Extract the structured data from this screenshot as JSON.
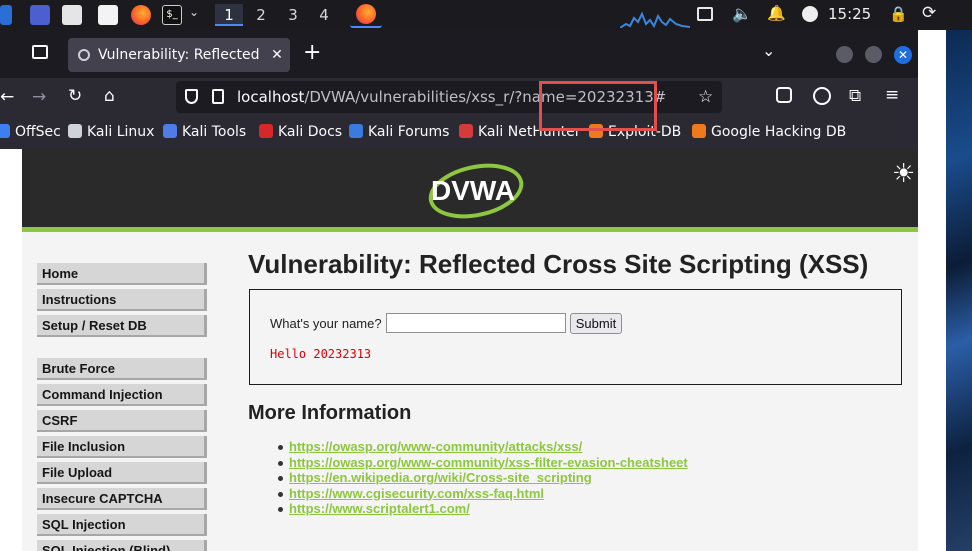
{
  "taskbar": {
    "workspaces": [
      "1",
      "2",
      "3",
      "4"
    ],
    "active_workspace": "1",
    "clock": "15:25",
    "icons": [
      "kali-menu-icon",
      "workspace-icon",
      "file-manager-icon",
      "text-editor-icon",
      "firefox-icon",
      "terminal-icon",
      "chevron-down-icon"
    ]
  },
  "browser": {
    "tab_title": "Vulnerability: Reflected Cr",
    "url_host": "localhost",
    "url_path": "/DVWA/vulnerabilities/xss_r/?name=20232313#",
    "bookmarks": [
      "OffSec",
      "Kali Linux",
      "Kali Tools",
      "Kali Docs",
      "Kali Forums",
      "Kali NetHunter",
      "Exploit-DB",
      "Google Hacking DB"
    ]
  },
  "page": {
    "logo_text": "DVWA",
    "menu_group1": [
      "Home",
      "Instructions",
      "Setup / Reset DB"
    ],
    "menu_group2": [
      "Brute Force",
      "Command Injection",
      "CSRF",
      "File Inclusion",
      "File Upload",
      "Insecure CAPTCHA",
      "SQL Injection",
      "SQL Injection (Blind)"
    ],
    "title": "Vulnerability: Reflected Cross Site Scripting (XSS)",
    "form": {
      "label": "What's your name?",
      "input_value": "",
      "submit_label": "Submit",
      "result": "Hello 20232313"
    },
    "more_info_heading": "More Information",
    "links": [
      "https://owasp.org/www-community/attacks/xss/",
      "https://owasp.org/www-community/xss-filter-evasion-cheatsheet",
      "https://en.wikipedia.org/wiki/Cross-site_scripting",
      "https://www.cgisecurity.com/xss-faq.html",
      "https://www.scriptalert1.com/"
    ]
  },
  "colors": {
    "accent_green": "#8dc63f",
    "highlight_red": "#e2504e",
    "result_red": "#dd0000"
  }
}
